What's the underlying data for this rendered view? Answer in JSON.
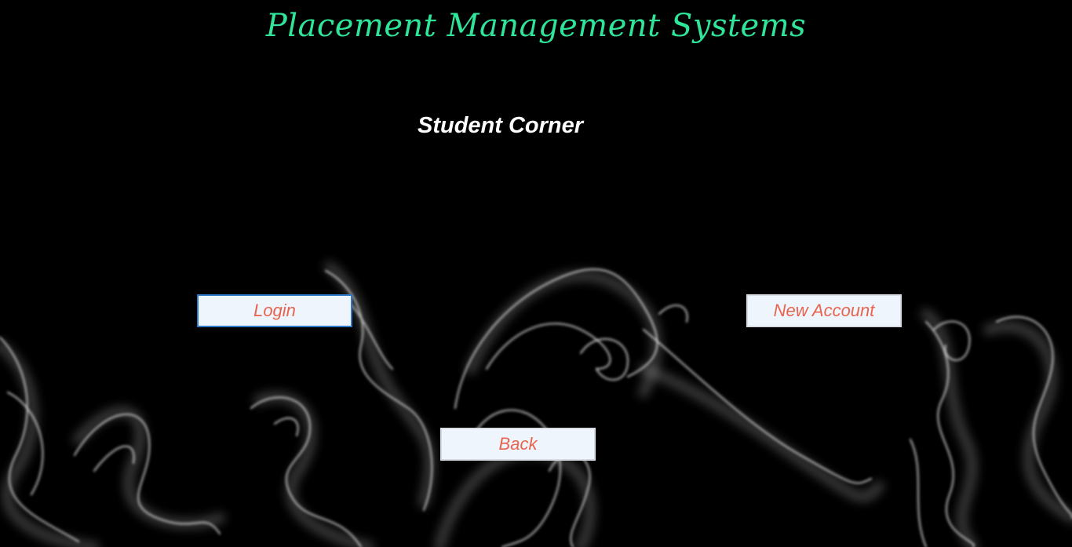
{
  "app": {
    "title": "Placement Management Systems",
    "section_title": "Student Corner"
  },
  "buttons": {
    "login": "Login",
    "new_account": "New Account",
    "back": "Back"
  },
  "colors": {
    "background": "#000000",
    "title": "#2ee59a",
    "section_title": "#ffffff",
    "button_bg": "#eef5fc",
    "button_text": "#e8644e",
    "focus_border": "#2f78c8"
  }
}
